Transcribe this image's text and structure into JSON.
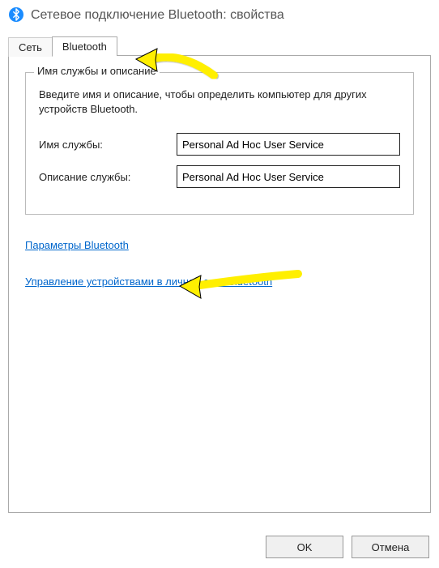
{
  "window": {
    "title": "Сетевое подключение Bluetooth: свойства"
  },
  "tabs": {
    "inactive": "Сеть",
    "active": "Bluetooth"
  },
  "group": {
    "legend": "Имя службы и описание",
    "description": "Введите имя и описание, чтобы определить компьютер для других устройств Bluetooth.",
    "name_label": "Имя службы:",
    "name_value": "Personal Ad Hoc User Service",
    "desc_label": "Описание службы:",
    "desc_value": "Personal Ad Hoc User Service"
  },
  "links": {
    "params": "Параметры Bluetooth",
    "manage": "Управление устройствами в личной сети Bluetooth"
  },
  "buttons": {
    "ok": "OK",
    "cancel": "Отмена"
  }
}
